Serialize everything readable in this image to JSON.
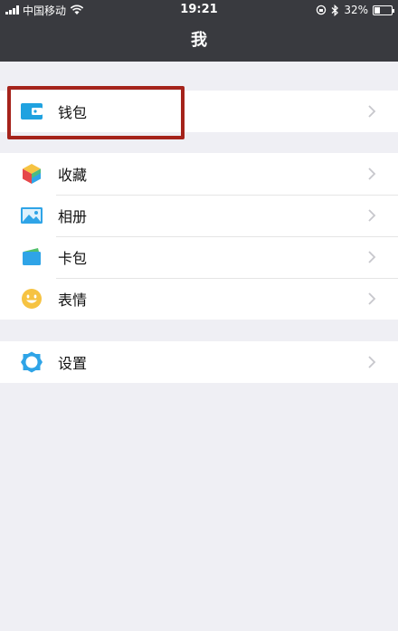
{
  "status_bar": {
    "carrier": "中国移动",
    "time": "19:21",
    "battery": "32%",
    "battery_level": 0.32
  },
  "nav": {
    "title": "我"
  },
  "groups": [
    {
      "items": [
        {
          "label": "钱包",
          "icon": "wallet-icon"
        }
      ]
    },
    {
      "items": [
        {
          "label": "收藏",
          "icon": "cube-icon"
        },
        {
          "label": "相册",
          "icon": "photo-icon"
        },
        {
          "label": "卡包",
          "icon": "card-icon"
        },
        {
          "label": "表情",
          "icon": "smiley-icon"
        }
      ]
    },
    {
      "items": [
        {
          "label": "设置",
          "icon": "gear-icon"
        }
      ]
    }
  ],
  "colors": {
    "nav_background": "#393a3f",
    "page_background": "#efeff4",
    "highlight_border": "#a5231b"
  }
}
